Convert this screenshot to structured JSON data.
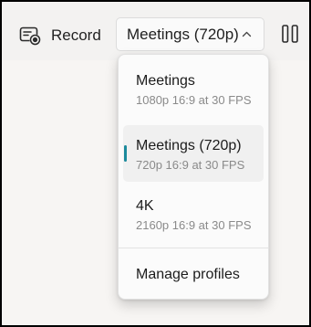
{
  "toolbar": {
    "record_label": "Record",
    "record_icon": "record-screen-icon",
    "profile_value": "Meetings (720p)",
    "chevron_icon": "chevron-up-icon",
    "pause_icon": "pause-icon"
  },
  "dropdown": {
    "options": [
      {
        "title": "Meetings",
        "subtitle": "1080p 16:9 at 30 FPS",
        "selected": false
      },
      {
        "title": "Meetings (720p)",
        "subtitle": "720p 16:9 at 30 FPS",
        "selected": true
      },
      {
        "title": "4K",
        "subtitle": "2160p 16:9 at 30 FPS",
        "selected": false
      }
    ],
    "manage_label": "Manage profiles"
  },
  "colors": {
    "accent": "#1b8a9c",
    "selected_bg": "#f0f0f0",
    "subtitle_text": "#8a8a8a",
    "toolbar_bg": "#f3f2f1"
  }
}
